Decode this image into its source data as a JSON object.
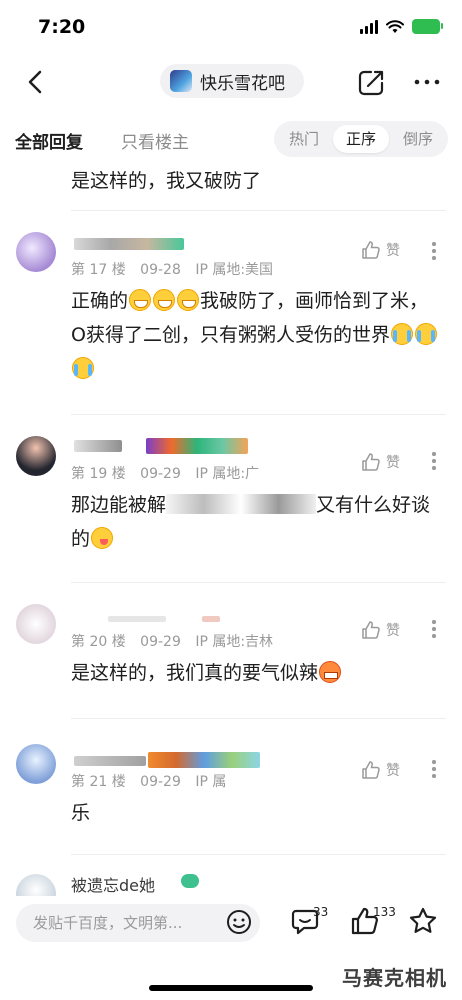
{
  "status_bar": {
    "time": "7:20"
  },
  "nav": {
    "forum_name": "快乐雪花吧"
  },
  "tabs": {
    "all_replies": "全部回复",
    "op_only": "只看楼主",
    "sort_options": [
      "热门",
      "正序",
      "倒序"
    ],
    "active_sort": "正序"
  },
  "thread": {
    "cut_off_text": "是这样的，我又破防了",
    "like_label": "赞",
    "posts": [
      {
        "floor": "第 17 楼",
        "date": "09-28",
        "ip": "IP 属地:美国",
        "text_segments": [
          "正确的",
          "我破防了，画师恰到了米，O获得了二创，只有粥粥人受伤的世界"
        ]
      },
      {
        "floor": "第 19 楼",
        "date": "09-29",
        "ip": "IP 属地:广",
        "text_segments": [
          "那边能被解",
          "又有什么好谈的"
        ]
      },
      {
        "floor": "第 20 楼",
        "date": "09-29",
        "ip": "IP 属地:吉林",
        "text_segments": [
          "是这样的，我们真的要气似辣"
        ]
      },
      {
        "floor": "第 21 楼",
        "date": "09-29",
        "ip": "IP 属",
        "text_segments": [
          "乐"
        ]
      },
      {
        "username": "被遗忘de她"
      }
    ]
  },
  "bottom_bar": {
    "reply_placeholder": "发贴千百度，文明第...",
    "comment_count": "33",
    "like_count": "133"
  },
  "watermark": "马赛克相机",
  "colors": {
    "accent_green": "#2fbd51",
    "text_primary": "#1e1e1e",
    "text_secondary": "#9a9a9a",
    "pill_bg": "#f2f2f4"
  }
}
